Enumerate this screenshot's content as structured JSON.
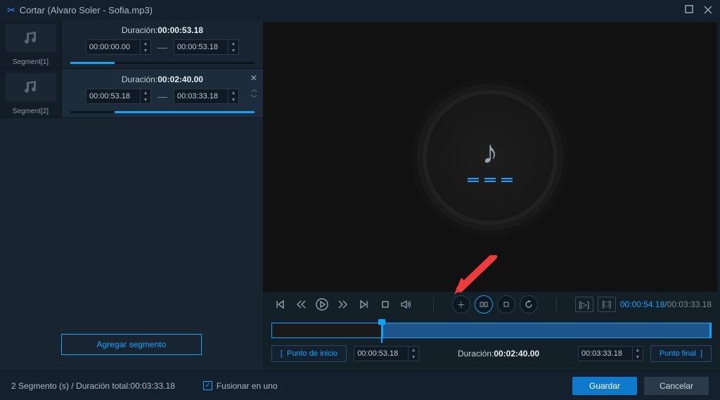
{
  "window": {
    "title": "Cortar (Alvaro Soler - Sofia.mp3)"
  },
  "segments": [
    {
      "label": "Segment[1]",
      "duration_label": "Duración:",
      "duration_value": "00:00:53.18",
      "start": "00:00:00.00",
      "end": "00:00:53.18",
      "bar_left_pct": 0,
      "bar_width_pct": 24
    },
    {
      "label": "Segment[2]",
      "duration_label": "Duración:",
      "duration_value": "00:02:40.00",
      "start": "00:00:53.18",
      "end": "00:03:33.18",
      "bar_left_pct": 24,
      "bar_width_pct": 76
    }
  ],
  "add_segment_label": "Agregar segmento",
  "playback": {
    "current": "00:00:54.18",
    "total": "00:03:33.18"
  },
  "range": {
    "start_btn": "Punto de inicio",
    "end_btn": "Punto final",
    "start_time": "00:00:53.18",
    "end_time": "00:03:33.18",
    "dur_label": "Duración:",
    "dur_value": "00:02:40.00",
    "sel_left_pct": 25,
    "sel_width_pct": 75
  },
  "footer": {
    "status": "2 Segmento (s) / Duración total:00:03:33.18",
    "merge_label": "Fusionar en uno",
    "save": "Guardar",
    "cancel": "Cancelar"
  },
  "icons": {
    "note": "♪"
  }
}
